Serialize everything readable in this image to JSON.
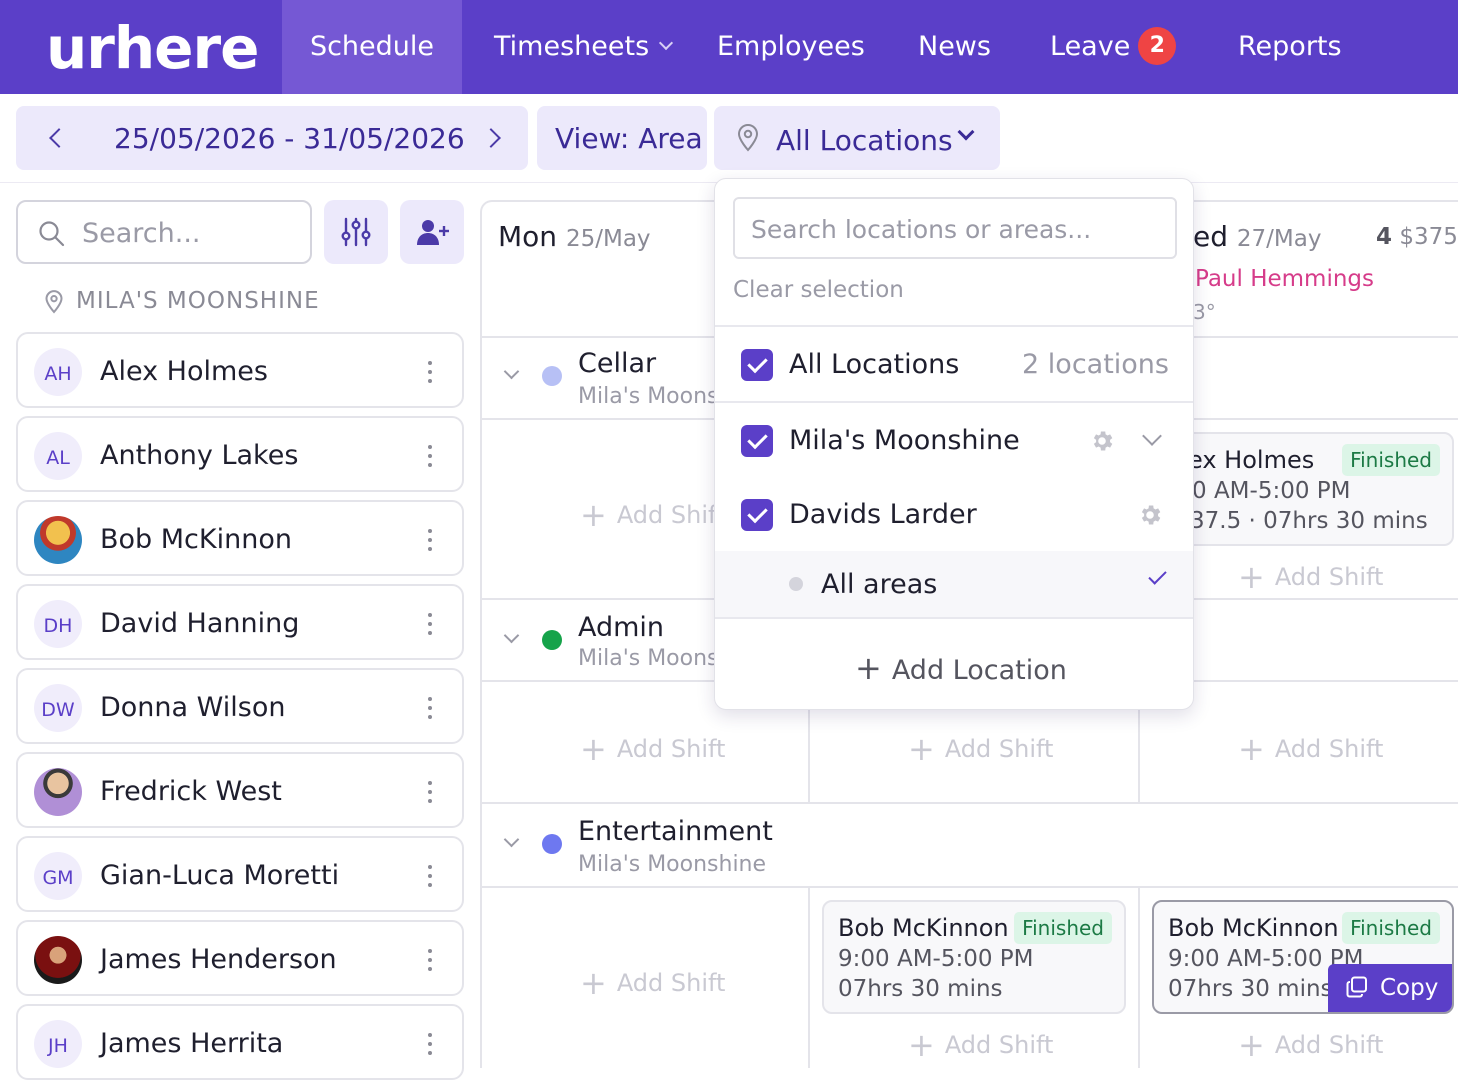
{
  "nav": {
    "logo": "urhere",
    "items": [
      "Schedule",
      "Timesheets",
      "Employees",
      "News",
      "Leave",
      "Reports"
    ],
    "leave_badge": "2",
    "active": "Schedule"
  },
  "toolbar": {
    "date_range": "25/05/2026 - 31/05/2026",
    "view_label": "View: Area",
    "location_label": "All Locations"
  },
  "sidebar": {
    "search_placeholder": "Search...",
    "location_heading": "MILA'S MOONSHINE",
    "employees": [
      {
        "initials": "AH",
        "name": "Alex Holmes"
      },
      {
        "initials": "AL",
        "name": "Anthony Lakes"
      },
      {
        "initials": "",
        "name": "Bob McKinnon"
      },
      {
        "initials": "DH",
        "name": "David Hanning"
      },
      {
        "initials": "DW",
        "name": "Donna Wilson"
      },
      {
        "initials": "",
        "name": "Fredrick West"
      },
      {
        "initials": "GM",
        "name": "Gian-Luca Moretti"
      },
      {
        "initials": "",
        "name": "James Henderson"
      },
      {
        "initials": "JH",
        "name": "James Herrita"
      }
    ]
  },
  "calendar": {
    "day1": {
      "dow": "Mon",
      "date": "25/May"
    },
    "day3": {
      "dow_partial": "ed",
      "date": "27/May",
      "count": "4",
      "cost": "$375",
      "manager": "Paul Hemmings",
      "weather_partial": "3°"
    },
    "add_shift": "Add Shift",
    "areas": [
      {
        "name": "Cellar",
        "sub": "Mila's Moonshine",
        "color": "#b7c0f5"
      },
      {
        "name": "Admin",
        "sub": "Mila's Moonshine",
        "color": "#16a34a"
      },
      {
        "name": "Entertainment",
        "sub": "Mila's Moonshine",
        "color": "#6e78f0"
      }
    ],
    "shift_cellar_wed": {
      "name_partial": "ex Holmes",
      "status": "Finished",
      "time_partial": "0 AM-5:00 PM",
      "details_partial": "37.5 · 07hrs 30 mins"
    },
    "shift_ent_tue": {
      "name": "Bob McKinnon",
      "status": "Finished",
      "time": "9:00 AM-5:00 PM",
      "duration": "07hrs 30 mins"
    },
    "shift_ent_wed": {
      "name": "Bob McKinnon",
      "status": "Finished",
      "time": "9:00 AM-5:00 PM",
      "duration": "07hrs 30 mins",
      "copy_label": "Copy"
    }
  },
  "dropdown": {
    "search_placeholder": "Search locations or areas...",
    "clear_label": "Clear selection",
    "all_locations": "All Locations",
    "count": "2 locations",
    "locations": [
      "Mila's Moonshine",
      "Davids Larder"
    ],
    "all_areas": "All areas",
    "add_location": "Add Location"
  },
  "colors": {
    "brand": "#5b3fc8",
    "finished_bg": "#dcf5e7",
    "manager": "#d63c8a"
  }
}
